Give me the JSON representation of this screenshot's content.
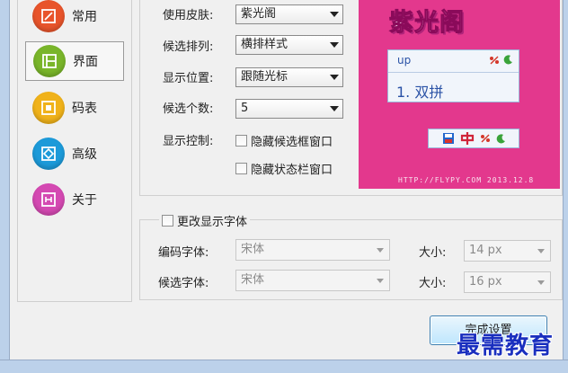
{
  "nav": {
    "items": [
      {
        "label": "常用",
        "icon": "frame-icon",
        "color": "#e8542b",
        "selected": false
      },
      {
        "label": "界面",
        "icon": "layout-icon",
        "color": "#79b52a",
        "selected": true
      },
      {
        "label": "码表",
        "icon": "table-icon",
        "color": "#f0b21a",
        "selected": false
      },
      {
        "label": "高级",
        "icon": "diamond-icon",
        "color": "#1c9ad9",
        "selected": false
      },
      {
        "label": "关于",
        "icon": "info-icon",
        "color": "#d449b2",
        "selected": false
      }
    ]
  },
  "interface": {
    "skin_label": "使用皮肤:",
    "skin_value": "紫光阁",
    "arrange_label": "候选排列:",
    "arrange_value": "横排样式",
    "position_label": "显示位置:",
    "position_value": "跟随光标",
    "count_label": "候选个数:",
    "count_value": "5",
    "control_label": "显示控制:",
    "hide_candidate_label": "隐藏候选框窗口",
    "hide_status_label": "隐藏状态栏窗口"
  },
  "preview": {
    "title": "紫光阁",
    "input_text": "up",
    "candidate_text": "1. 双拼",
    "footer_text": "HTTP://FLYPY.COM   2013.12.8",
    "background_color": "#e3388d"
  },
  "font": {
    "group_label": "更改显示字体",
    "code_font_label": "编码字体:",
    "code_font_value": "宋体",
    "code_size_label": "大小:",
    "code_size_value": "14 px",
    "cand_font_label": "候选字体:",
    "cand_font_value": "宋体",
    "cand_size_label": "大小:",
    "cand_size_value": "16 px"
  },
  "finish_button": {
    "label": "完成设置"
  },
  "watermark": {
    "text": "最需教育"
  }
}
